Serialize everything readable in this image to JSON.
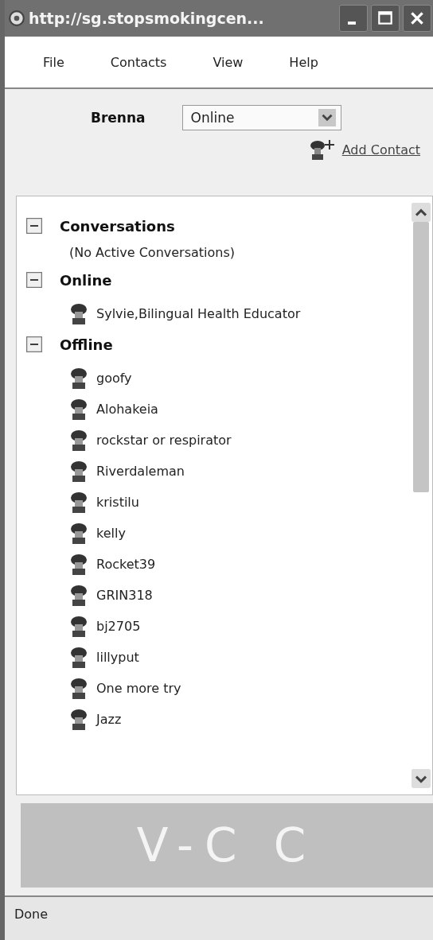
{
  "window": {
    "title": "http://sg.stopsmokingcen..."
  },
  "menu": [
    "File",
    "Contacts",
    "View",
    "Help"
  ],
  "user": {
    "name": "Brenna",
    "status": "Online",
    "add_contact": "Add Contact"
  },
  "groups": [
    {
      "label": "Conversations",
      "expanded": true,
      "children": [
        {
          "kind": "note",
          "label": "(No Active Conversations)"
        }
      ]
    },
    {
      "label": "Online",
      "expanded": true,
      "children": [
        {
          "kind": "contact",
          "label": "Sylvie,Bilingual Health Educator"
        }
      ]
    },
    {
      "label": "Offline",
      "expanded": true,
      "children": [
        {
          "kind": "contact",
          "label": "goofy"
        },
        {
          "kind": "contact",
          "label": "Alohakeia"
        },
        {
          "kind": "contact",
          "label": "rockstar or respirator"
        },
        {
          "kind": "contact",
          "label": "Riverdaleman"
        },
        {
          "kind": "contact",
          "label": "kristilu"
        },
        {
          "kind": "contact",
          "label": "kelly"
        },
        {
          "kind": "contact",
          "label": "Rocket39"
        },
        {
          "kind": "contact",
          "label": "GRIN318"
        },
        {
          "kind": "contact",
          "label": "bj2705"
        },
        {
          "kind": "contact",
          "label": "lillyput"
        },
        {
          "kind": "contact",
          "label": "One more try"
        },
        {
          "kind": "contact",
          "label": "Jazz"
        }
      ]
    }
  ],
  "banner": {
    "text": "V-C C"
  },
  "status_bar": "Done"
}
